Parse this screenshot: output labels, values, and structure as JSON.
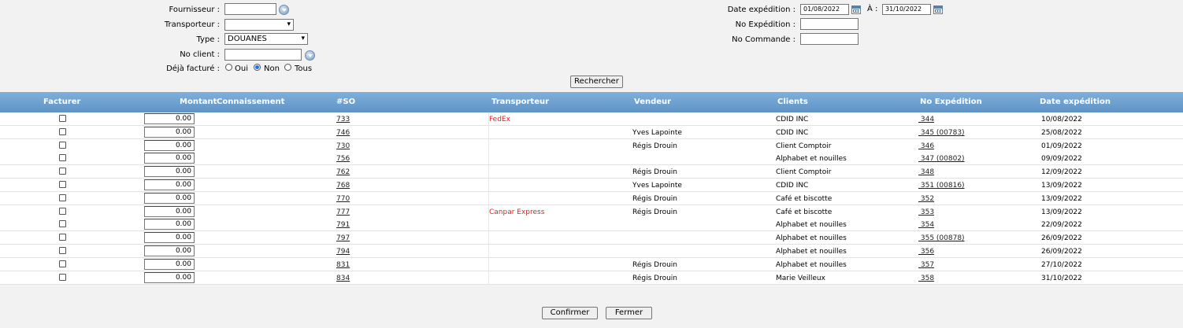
{
  "filters": {
    "fournisseur_label": "Fournisseur :",
    "transporteur_label": "Transporteur :",
    "type_label": "Type :",
    "type_value": "DOUANES",
    "noclient_label": "No client :",
    "deja_facture_label": "Déjà facturé :",
    "radio_oui": "Oui",
    "radio_non": "Non",
    "radio_tous": "Tous",
    "date_exp_label": "Date expédition :",
    "date_from": "01/08/2022",
    "a_label": "À :",
    "date_to": "31/10/2022",
    "no_expedition_label": "No Expédition :",
    "no_commande_label": "No Commande :",
    "search_button": "Rechercher"
  },
  "table": {
    "headers": {
      "facturer": "Facturer",
      "montant": "Montant",
      "connaissement": "Connaissement",
      "so": "#SO",
      "transporteur": "Transporteur",
      "vendeur": "Vendeur",
      "clients": "Clients",
      "no_expedition": "No Expédition",
      "date_expedition": "Date expédition"
    },
    "rows": [
      {
        "montant": "0.00",
        "so": "733",
        "transporteur": "FedEx",
        "vendeur": "",
        "client": "CDID INC",
        "no_exp": " 344",
        "date": "10/08/2022"
      },
      {
        "montant": "0.00",
        "so": "746",
        "transporteur": "",
        "vendeur": "Yves Lapointe",
        "client": "CDID INC",
        "no_exp": " 345 (00783)",
        "date": "25/08/2022"
      },
      {
        "montant": "0.00",
        "so": "730",
        "transporteur": "",
        "vendeur": "Régis Drouin",
        "client": "Client Comptoir",
        "no_exp": " 346",
        "date": "01/09/2022"
      },
      {
        "montant": "0.00",
        "so": "756",
        "transporteur": "",
        "vendeur": "",
        "client": "Alphabet et nouilles",
        "no_exp": " 347 (00802)",
        "date": "09/09/2022"
      },
      {
        "montant": "0.00",
        "so": "762",
        "transporteur": "",
        "vendeur": "Régis Drouin",
        "client": "Client Comptoir",
        "no_exp": " 348",
        "date": "12/09/2022"
      },
      {
        "montant": "0.00",
        "so": "768",
        "transporteur": "",
        "vendeur": "Yves Lapointe",
        "client": "CDID INC",
        "no_exp": " 351 (00816)",
        "date": "13/09/2022"
      },
      {
        "montant": "0.00",
        "so": "770",
        "transporteur": "",
        "vendeur": "Régis Drouin",
        "client": "Café et biscotte",
        "no_exp": " 352",
        "date": "13/09/2022"
      },
      {
        "montant": "0.00",
        "so": "777",
        "transporteur": "Canpar Express",
        "vendeur": "Régis Drouin",
        "client": "Café et biscotte",
        "no_exp": " 353",
        "date": "13/09/2022"
      },
      {
        "montant": "0.00",
        "so": "791",
        "transporteur": "",
        "vendeur": "",
        "client": "Alphabet et nouilles",
        "no_exp": " 354",
        "date": "22/09/2022"
      },
      {
        "montant": "0.00",
        "so": "797",
        "transporteur": "",
        "vendeur": "",
        "client": "Alphabet et nouilles",
        "no_exp": " 355 (00878)",
        "date": "26/09/2022"
      },
      {
        "montant": "0.00",
        "so": "794",
        "transporteur": "",
        "vendeur": "",
        "client": "Alphabet et nouilles",
        "no_exp": " 356",
        "date": "26/09/2022"
      },
      {
        "montant": "0.00",
        "so": "831",
        "transporteur": "",
        "vendeur": "Régis Drouin",
        "client": "Alphabet et nouilles",
        "no_exp": " 357",
        "date": "27/10/2022"
      },
      {
        "montant": "0.00",
        "so": "834",
        "transporteur": "",
        "vendeur": "Régis Drouin",
        "client": "Marie Veilleux",
        "no_exp": " 358",
        "date": "31/10/2022"
      }
    ]
  },
  "footer": {
    "confirm_button": "Confirmer",
    "close_button": "Fermer"
  },
  "colors": {
    "header_bg": "#6fa3d2",
    "carrier_text": "#e02020"
  }
}
